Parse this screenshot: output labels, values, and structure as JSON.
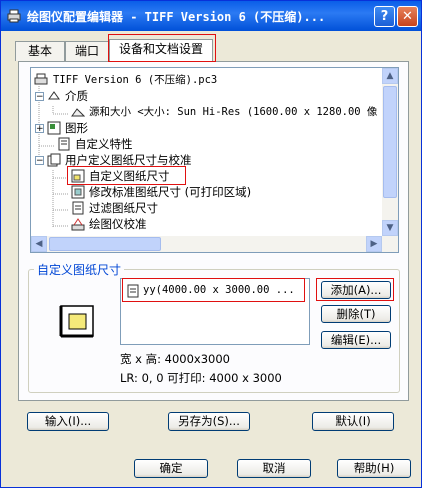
{
  "window": {
    "title": "绘图仪配置编辑器 - TIFF Version 6 (不压缩)..."
  },
  "titlebar_buttons": {
    "help": "?",
    "close": "✕"
  },
  "tabs": [
    {
      "label": "基本"
    },
    {
      "label": "端口"
    },
    {
      "label": "设备和文档设置"
    }
  ],
  "tree": {
    "root": "TIFF Version 6 (不压缩).pc3",
    "items": [
      {
        "label": "介质"
      },
      {
        "label": "源和大小 <大小: Sun Hi-Res (1600.00 x 1280.00 像"
      },
      {
        "label": "图形"
      },
      {
        "label": "自定义特性"
      },
      {
        "label": "用户定义图纸尺寸与校准"
      },
      {
        "label": "自定义图纸尺寸"
      },
      {
        "label": "修改标准图纸尺寸 (可打印区域)"
      },
      {
        "label": "过滤图纸尺寸"
      },
      {
        "label": "绘图仪校准"
      }
    ]
  },
  "custom_paper": {
    "group_title": "自定义图纸尺寸",
    "list_items": [
      "yy(4000.00 x 3000.00 ..."
    ],
    "buttons": {
      "add": "添加(A)...",
      "delete": "删除(T)",
      "edit": "编辑(E)..."
    },
    "info_size": "宽 x 高: 4000x3000",
    "info_lr": "LR: 0, 0  可打印: 4000 x 3000"
  },
  "panel_buttons": {
    "import": "输入(I)...",
    "save_as": "另存为(S)...",
    "default": "默认(I)"
  },
  "dialog_buttons": {
    "ok": "确定",
    "cancel": "取消",
    "help": "帮助(H)"
  },
  "colors": {
    "titlebar": "#0a5ee8",
    "group_title": "#0046d5",
    "highlight": "#e01010"
  }
}
